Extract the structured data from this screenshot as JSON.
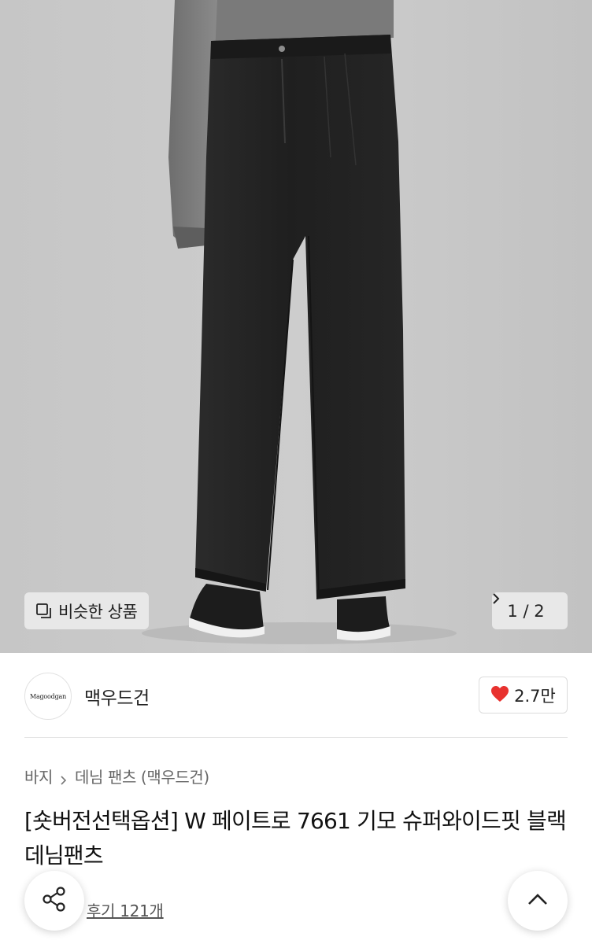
{
  "gallery": {
    "similar_button_label": "비슷한 상품",
    "pager_text": "1 / 2"
  },
  "brand": {
    "logo_text": "Magoodgan",
    "name": "맥우드건",
    "like_count": "2.7만",
    "like_color": "#e8322f"
  },
  "breadcrumb": {
    "items": [
      "바지",
      "데님 팬츠 (맥우드건)"
    ]
  },
  "product": {
    "title": "[숏버전선택옵션] W 페이트로 7661 기모 슈퍼와이드핏 블랙 데님팬츠",
    "review_link": "후기 121개"
  }
}
